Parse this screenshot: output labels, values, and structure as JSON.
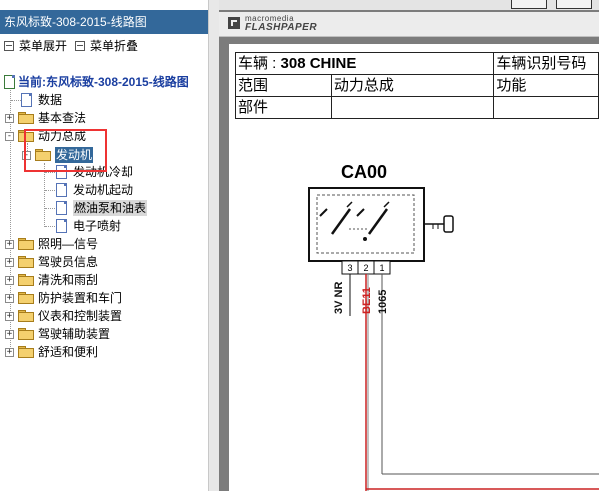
{
  "panel": {
    "title": "东风标致-308-2015-线路图",
    "expand_all": "菜单展开",
    "collapse_all": "菜单折叠"
  },
  "tree": {
    "current": "当前:东风标致-308-2015-线路图",
    "items": {
      "data": "数据",
      "basic": "基本查法",
      "powertrain": "动力总成",
      "engine": "发动机",
      "engine_cooling": "发动机冷却",
      "engine_start": "发动机起动",
      "fuel_pump": "燃油泵和油表",
      "injection": "电子喷射",
      "lighting": "照明—信号",
      "driver_info": "驾驶员信息",
      "wash_wipe": "清洗和雨刮",
      "protection": "防护装置和车门",
      "instruments": "仪表和控制装置",
      "driving_aids": "驾驶辅助装置",
      "comfort": "舒适和便利"
    }
  },
  "viewer": {
    "brand_small": "macromedia",
    "brand_big": "FLASHPAPER"
  },
  "document": {
    "vehicle_label": "车辆 : ",
    "vehicle_value": "308 CHINE",
    "vin_label": "车辆识别号码",
    "scope_label": "范围",
    "scope_value": "动力总成",
    "function_label": "功能",
    "part_label": "部件",
    "component": "CA00",
    "pins": [
      "3",
      "2",
      "1"
    ],
    "wire_labels": [
      "3V NR",
      "BE11",
      "1065"
    ]
  },
  "colors": {
    "panel_header": "#33689a",
    "highlight_box": "#ee3333",
    "wire_red": "#cc2222"
  }
}
